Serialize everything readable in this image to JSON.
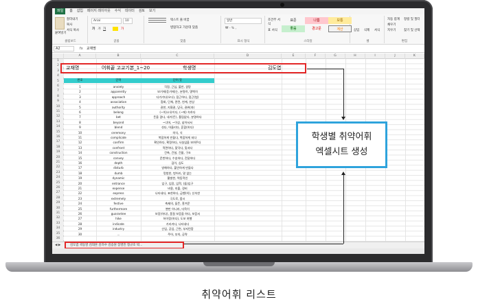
{
  "caption": "취약어휘 리스트",
  "callout": {
    "line1": "학생별 취약어휘",
    "line2": "엑셀시트 생성"
  },
  "excel": {
    "tabs": [
      "파일",
      "홈",
      "삽입",
      "페이지 레이아웃",
      "수식",
      "데이터",
      "검토",
      "보기"
    ],
    "ribbon": {
      "clipboard_label": "클립보드",
      "font_label": "글꼴",
      "align_label": "맞춤",
      "number_label": "표시 형식",
      "styles_label": "스타일",
      "cells_label": "셀",
      "edit_label": "편집",
      "font_name": "Arial",
      "font_size": "10",
      "wrap_text": "텍스트 줄 바꿈",
      "merge": "병합하고 가운데 맞춤",
      "number_format": "일반",
      "paste": "붙여넣기",
      "cut": "잘라내기",
      "copy": "복사",
      "format_painter": "서식 복사",
      "conditional": "조건부 서식",
      "table_format": "표 서식",
      "styles": [
        {
          "label": "표준",
          "bg": "#ffffff"
        },
        {
          "label": "나쁨",
          "bg": "#ffc7ce"
        },
        {
          "label": "보통",
          "bg": "#ffeb9c"
        },
        {
          "label": "좋음",
          "bg": "#c6efce"
        },
        {
          "label": "경고문",
          "bg": "#ffffff"
        },
        {
          "label": "계산",
          "bg": "#f2f2f2"
        }
      ],
      "insert": "삽입",
      "delete": "삭제",
      "format": "서식",
      "autosum": "자동 합계",
      "fill": "채우기",
      "clear": "지우기",
      "sort": "정렬 및 필터",
      "find": "찾기 및 선택"
    },
    "name_box": "A2",
    "fx": "fx",
    "formula_value": "교재명",
    "columns": [
      "A",
      "B",
      "C",
      "D",
      "E",
      "F",
      "G",
      "H",
      "I",
      "J",
      "K"
    ],
    "title_row": {
      "textbook_label": "교재명",
      "vocab_title": "어휘끝 고교기본_1~20",
      "student_label": "학생명",
      "student_name": "김도엽"
    },
    "table_headers": [
      "번호",
      "단어",
      "단어 뜻"
    ],
    "rows": [
      [
        "1",
        "anxiety",
        "걱정, 근심, 불안, 갈망"
      ],
      [
        "2",
        "apparently",
        "보기에(듣기에)는, 분명히, 명백히"
      ],
      [
        "3",
        "approach",
        "다가가다(오다), 접근하다, 접근(법)"
      ],
      [
        "4",
        "association",
        "협회, 단체, 관련, 연계, 연상"
      ],
      [
        "5",
        "authority",
        "권한, 지휘권, 당국, 권위(자)"
      ],
      [
        "6",
        "belong",
        "(~의)소유이다, (~에) 속하다"
      ],
      [
        "7",
        "bet",
        "돈을 걸다, 내기(돈), 틀림없다, 분명하다"
      ],
      [
        "8",
        "beyond",
        "~너머, ~이상, 넘어서서"
      ],
      [
        "9",
        "blend",
        "섞다, 어울리다, 혼합(하다)"
      ],
      [
        "10",
        "ceremony",
        "의식, 식"
      ],
      [
        "11",
        "complicate",
        "복잡하게 만들다, 복잡하게 되다"
      ],
      [
        "12",
        "confirm",
        "확인하다, 확정하다, 사실임을 보여주다"
      ],
      [
        "13",
        "confront",
        "직면하다, 맞닥다, 맞서다"
      ],
      [
        "14",
        "construction",
        "건축, 건설, 건물, 구조"
      ],
      [
        "15",
        "convey",
        "운반하다, 수송하다, 전달하다"
      ],
      [
        "16",
        "depth",
        "깊이, 심도"
      ],
      [
        "17",
        "disturb",
        "방해하다, 불안하게 만들다"
      ],
      [
        "18",
        "dumb",
        "멍청한, 벙어리, 말 없는"
      ],
      [
        "19",
        "dynamic",
        "활발한, 역동적인"
      ],
      [
        "20",
        "entrance",
        "입구, 입장, 입학, (들)입구"
      ],
      [
        "21",
        "expense",
        "비용, 지출, 경비"
      ],
      [
        "22",
        "express",
        "나타내다, 표현하다, 급행(의), 신속한"
      ],
      [
        "23",
        "extremely",
        "극도로, 몹시"
      ],
      [
        "24",
        "festive",
        "축제의, 들뜬, 흥겨운"
      ],
      [
        "25",
        "furthermore",
        "뿐만 아니라, 더욱이"
      ],
      [
        "26",
        "guarantee",
        "보장(하다), 품질 보증을 하다, 보증서"
      ],
      [
        "27",
        "hike",
        "하이킹(하다), 도보 여행"
      ],
      [
        "28",
        "indicate",
        "가리키다, 나타내다"
      ],
      [
        "29",
        "industry",
        "산업, 공업, 근면, 부지런함"
      ],
      [
        "30",
        "...",
        "주어, 부의, 공략"
      ]
    ],
    "sheet_tabs": "김도엽  곽동영  김대훈  김하수  김승원  장영진  정규호  박..."
  }
}
